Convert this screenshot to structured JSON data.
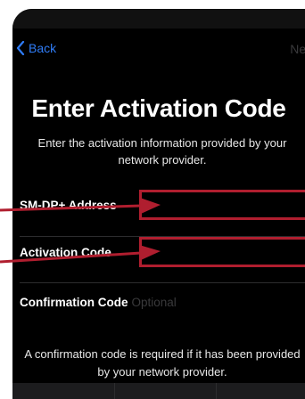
{
  "nav": {
    "back_label": "Back",
    "next_label": "Next"
  },
  "header": {
    "title": "Enter Activation Code",
    "subtitle": "Enter the activation information provided by your network provider."
  },
  "form": {
    "rows": [
      {
        "label": "SM-DP+ Address",
        "value": ""
      },
      {
        "label": "Activation Code",
        "value": ""
      },
      {
        "label": "Confirmation Code",
        "placeholder": "Optional"
      }
    ]
  },
  "footnote": "A confirmation code is required if it has been provided by your network provider.",
  "colors": {
    "accent": "#2f7cf6",
    "annotation": "#b01e2f",
    "background": "#000000",
    "disabled": "#3a3a3c"
  },
  "icons": {
    "back": "chevron-left-icon",
    "annotation": "arrow-right-icon"
  }
}
